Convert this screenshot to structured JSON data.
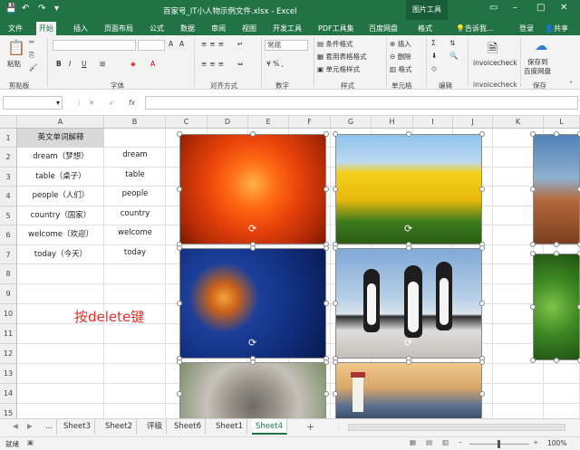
{
  "titlebar": {
    "filename": "百家号_IT小人物示例文件.xlsx - Excel",
    "picture_tools": "图片工具"
  },
  "tabs": [
    "文件",
    "开始",
    "插入",
    "页面布局",
    "公式",
    "数据",
    "审阅",
    "视图",
    "开发工具",
    "PDF工具集",
    "百度网盘",
    "格式"
  ],
  "active_tab": "开始",
  "tell_me": "告诉我...",
  "login": "登录",
  "share": "共享",
  "ribbon": {
    "paste": "粘贴",
    "clipboard": "剪贴板",
    "font": "字体",
    "alignment": "对齐方式",
    "number": "数字",
    "number_format": "常规",
    "conditional": "条件格式",
    "table_format": "套用表格格式",
    "cell_style": "单元格样式",
    "styles": "样式",
    "insert": "插入",
    "delete": "删除",
    "format": "格式",
    "cells": "单元格",
    "editing": "编辑",
    "invoice": "invoicecheck",
    "invoice_group": "invoicecheck",
    "save_baidu_1": "保存到",
    "save_baidu_2": "百度网盘",
    "save": "保存",
    "bold": "B",
    "italic": "I",
    "underline": "U"
  },
  "formula_bar": {
    "fx": "fx",
    "cancel": "✕",
    "enter": "✓"
  },
  "columns": [
    "A",
    "B",
    "C",
    "D",
    "E",
    "F",
    "G",
    "H",
    "I",
    "J",
    "K",
    "L"
  ],
  "rows": [
    "1",
    "2",
    "3",
    "4",
    "5",
    "6",
    "7",
    "8",
    "9",
    "10",
    "11",
    "12",
    "13",
    "14",
    "15"
  ],
  "header_cell": "英文单词解释",
  "table": [
    {
      "a": "dream（梦想）",
      "b": "dream"
    },
    {
      "a": "table（桌子）",
      "b": "table"
    },
    {
      "a": "people（人们）",
      "b": "people"
    },
    {
      "a": "country（国家）",
      "b": "country"
    },
    {
      "a": "welcome（欢迎）",
      "b": "welcome"
    },
    {
      "a": "today（今天）",
      "b": "today"
    }
  ],
  "note": "按delete键",
  "sheets": [
    "Sheet3",
    "Sheet2",
    "评级",
    "Sheet6",
    "Sheet1",
    "Sheet4"
  ],
  "active_sheet": "Sheet4",
  "sheet_ellipsis": "...",
  "add_sheet": "+",
  "status": {
    "ready": "就绪",
    "zoom": "100%"
  },
  "colors": {
    "excel_green": "#217346",
    "note_red": "#e0312c"
  }
}
